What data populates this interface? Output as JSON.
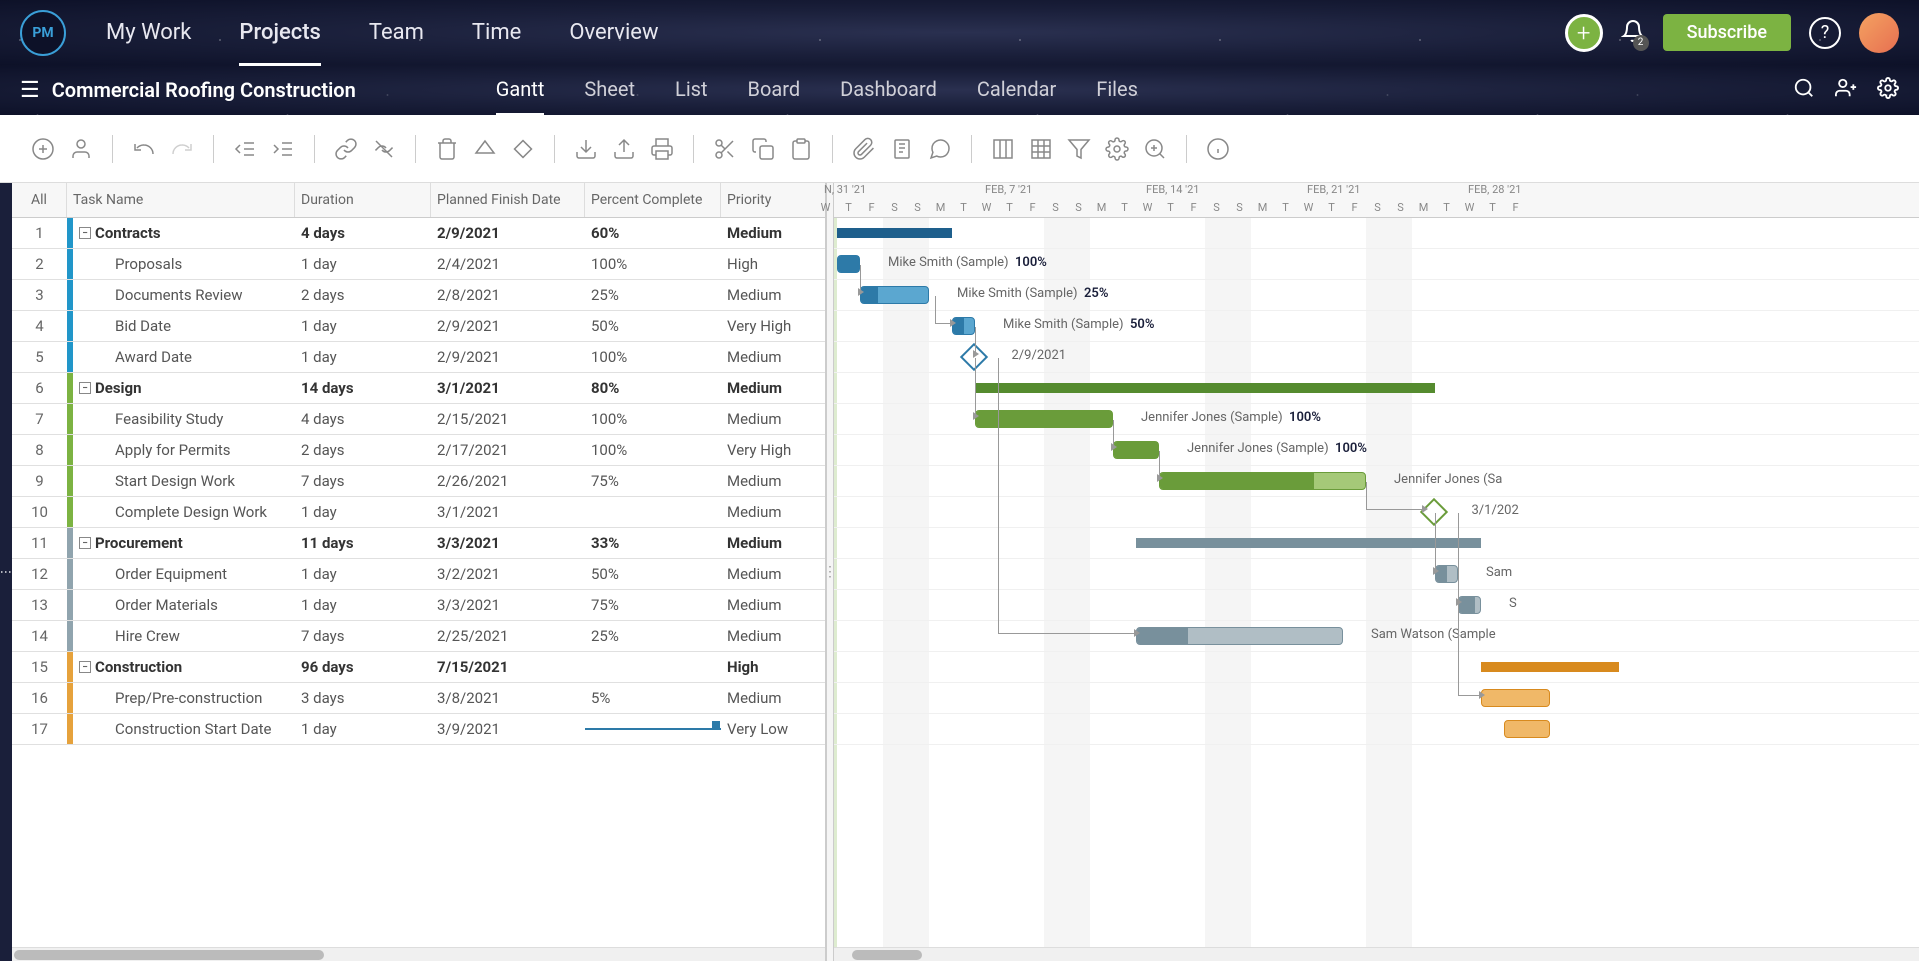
{
  "nav": {
    "logo": "PM",
    "items": [
      "My Work",
      "Projects",
      "Team",
      "Time",
      "Overview"
    ],
    "active": 1,
    "subscribe": "Subscribe",
    "bell_count": "2"
  },
  "sub_nav": {
    "project": "Commercial Roofing Construction",
    "views": [
      "Gantt",
      "Sheet",
      "List",
      "Board",
      "Dashboard",
      "Calendar",
      "Files"
    ],
    "active": 0
  },
  "grid": {
    "headers": {
      "all": "All",
      "name": "Task Name",
      "duration": "Duration",
      "date": "Planned Finish Date",
      "pct": "Percent Complete",
      "pri": "Priority"
    },
    "rows": [
      {
        "n": 1,
        "type": "parent",
        "stripe": "blue",
        "name": "Contracts",
        "dur": "4 days",
        "date": "2/9/2021",
        "pct": "60%",
        "pri": "Medium"
      },
      {
        "n": 2,
        "type": "child",
        "stripe": "blue",
        "name": "Proposals",
        "dur": "1 day",
        "date": "2/4/2021",
        "pct": "100%",
        "pri": "High"
      },
      {
        "n": 3,
        "type": "child",
        "stripe": "blue",
        "name": "Documents Review",
        "dur": "2 days",
        "date": "2/8/2021",
        "pct": "25%",
        "pri": "Medium"
      },
      {
        "n": 4,
        "type": "child",
        "stripe": "blue",
        "name": "Bid Date",
        "dur": "1 day",
        "date": "2/9/2021",
        "pct": "50%",
        "pri": "Very High"
      },
      {
        "n": 5,
        "type": "child",
        "stripe": "blue",
        "name": "Award Date",
        "dur": "1 day",
        "date": "2/9/2021",
        "pct": "100%",
        "pri": "Medium"
      },
      {
        "n": 6,
        "type": "parent",
        "stripe": "green",
        "name": "Design",
        "dur": "14 days",
        "date": "3/1/2021",
        "pct": "80%",
        "pri": "Medium"
      },
      {
        "n": 7,
        "type": "child",
        "stripe": "green",
        "name": "Feasibility Study",
        "dur": "4 days",
        "date": "2/15/2021",
        "pct": "100%",
        "pri": "Medium"
      },
      {
        "n": 8,
        "type": "child",
        "stripe": "green",
        "name": "Apply for Permits",
        "dur": "2 days",
        "date": "2/17/2021",
        "pct": "100%",
        "pri": "Very High"
      },
      {
        "n": 9,
        "type": "child",
        "stripe": "green",
        "name": "Start Design Work",
        "dur": "7 days",
        "date": "2/26/2021",
        "pct": "75%",
        "pri": "Medium"
      },
      {
        "n": 10,
        "type": "child",
        "stripe": "green",
        "name": "Complete Design Work",
        "dur": "1 day",
        "date": "3/1/2021",
        "pct": "",
        "pri": "Medium"
      },
      {
        "n": 11,
        "type": "parent",
        "stripe": "gray",
        "name": "Procurement",
        "dur": "11 days",
        "date": "3/3/2021",
        "pct": "33%",
        "pri": "Medium"
      },
      {
        "n": 12,
        "type": "child",
        "stripe": "gray",
        "name": "Order Equipment",
        "dur": "1 day",
        "date": "3/2/2021",
        "pct": "50%",
        "pri": "Medium"
      },
      {
        "n": 13,
        "type": "child",
        "stripe": "gray",
        "name": "Order Materials",
        "dur": "1 day",
        "date": "3/3/2021",
        "pct": "75%",
        "pri": "Medium"
      },
      {
        "n": 14,
        "type": "child",
        "stripe": "gray",
        "name": "Hire Crew",
        "dur": "7 days",
        "date": "2/25/2021",
        "pct": "25%",
        "pri": "Medium"
      },
      {
        "n": 15,
        "type": "parent",
        "stripe": "orange",
        "name": "Construction",
        "dur": "96 days",
        "date": "7/15/2021",
        "pct": "",
        "pri": "High"
      },
      {
        "n": 16,
        "type": "child",
        "stripe": "orange",
        "name": "Prep/Pre-construction",
        "dur": "3 days",
        "date": "3/8/2021",
        "pct": "5%",
        "pri": "Medium"
      },
      {
        "n": 17,
        "type": "child",
        "stripe": "orange",
        "name": "Construction Start Date",
        "dur": "1 day",
        "date": "3/9/2021",
        "pct": "",
        "pri": "Very Low",
        "editing": "pct"
      }
    ]
  },
  "gantt": {
    "weeks": [
      "N, 31 '21",
      "FEB, 7 '21",
      "FEB, 14 '21",
      "FEB, 21 '21",
      "FEB, 28 '21"
    ],
    "day_letters": [
      "W",
      "T",
      "F",
      "S",
      "S",
      "M",
      "T",
      "W",
      "T",
      "F",
      "S",
      "S",
      "M",
      "T",
      "W",
      "T",
      "F",
      "S",
      "S",
      "M",
      "T",
      "W",
      "T",
      "F",
      "S",
      "S",
      "M",
      "T",
      "W",
      "T",
      "F"
    ],
    "labels": {
      "r2": {
        "text": "Mike Smith (Sample)",
        "pct": "100%"
      },
      "r3": {
        "text": "Mike Smith (Sample)",
        "pct": "25%"
      },
      "r4": {
        "text": "Mike Smith (Sample)",
        "pct": "50%"
      },
      "r5": {
        "text": "2/9/2021"
      },
      "r7": {
        "text": "Jennifer Jones (Sample)",
        "pct": "100%"
      },
      "r8": {
        "text": "Jennifer Jones (Sample)",
        "pct": "100%"
      },
      "r9": {
        "text": "Jennifer Jones (Sa"
      },
      "r10": {
        "text": "3/1/202"
      },
      "r12": {
        "text": "Sam"
      },
      "r13": {
        "text": "S"
      },
      "r14": {
        "text": "Sam Watson (Sample"
      }
    }
  }
}
